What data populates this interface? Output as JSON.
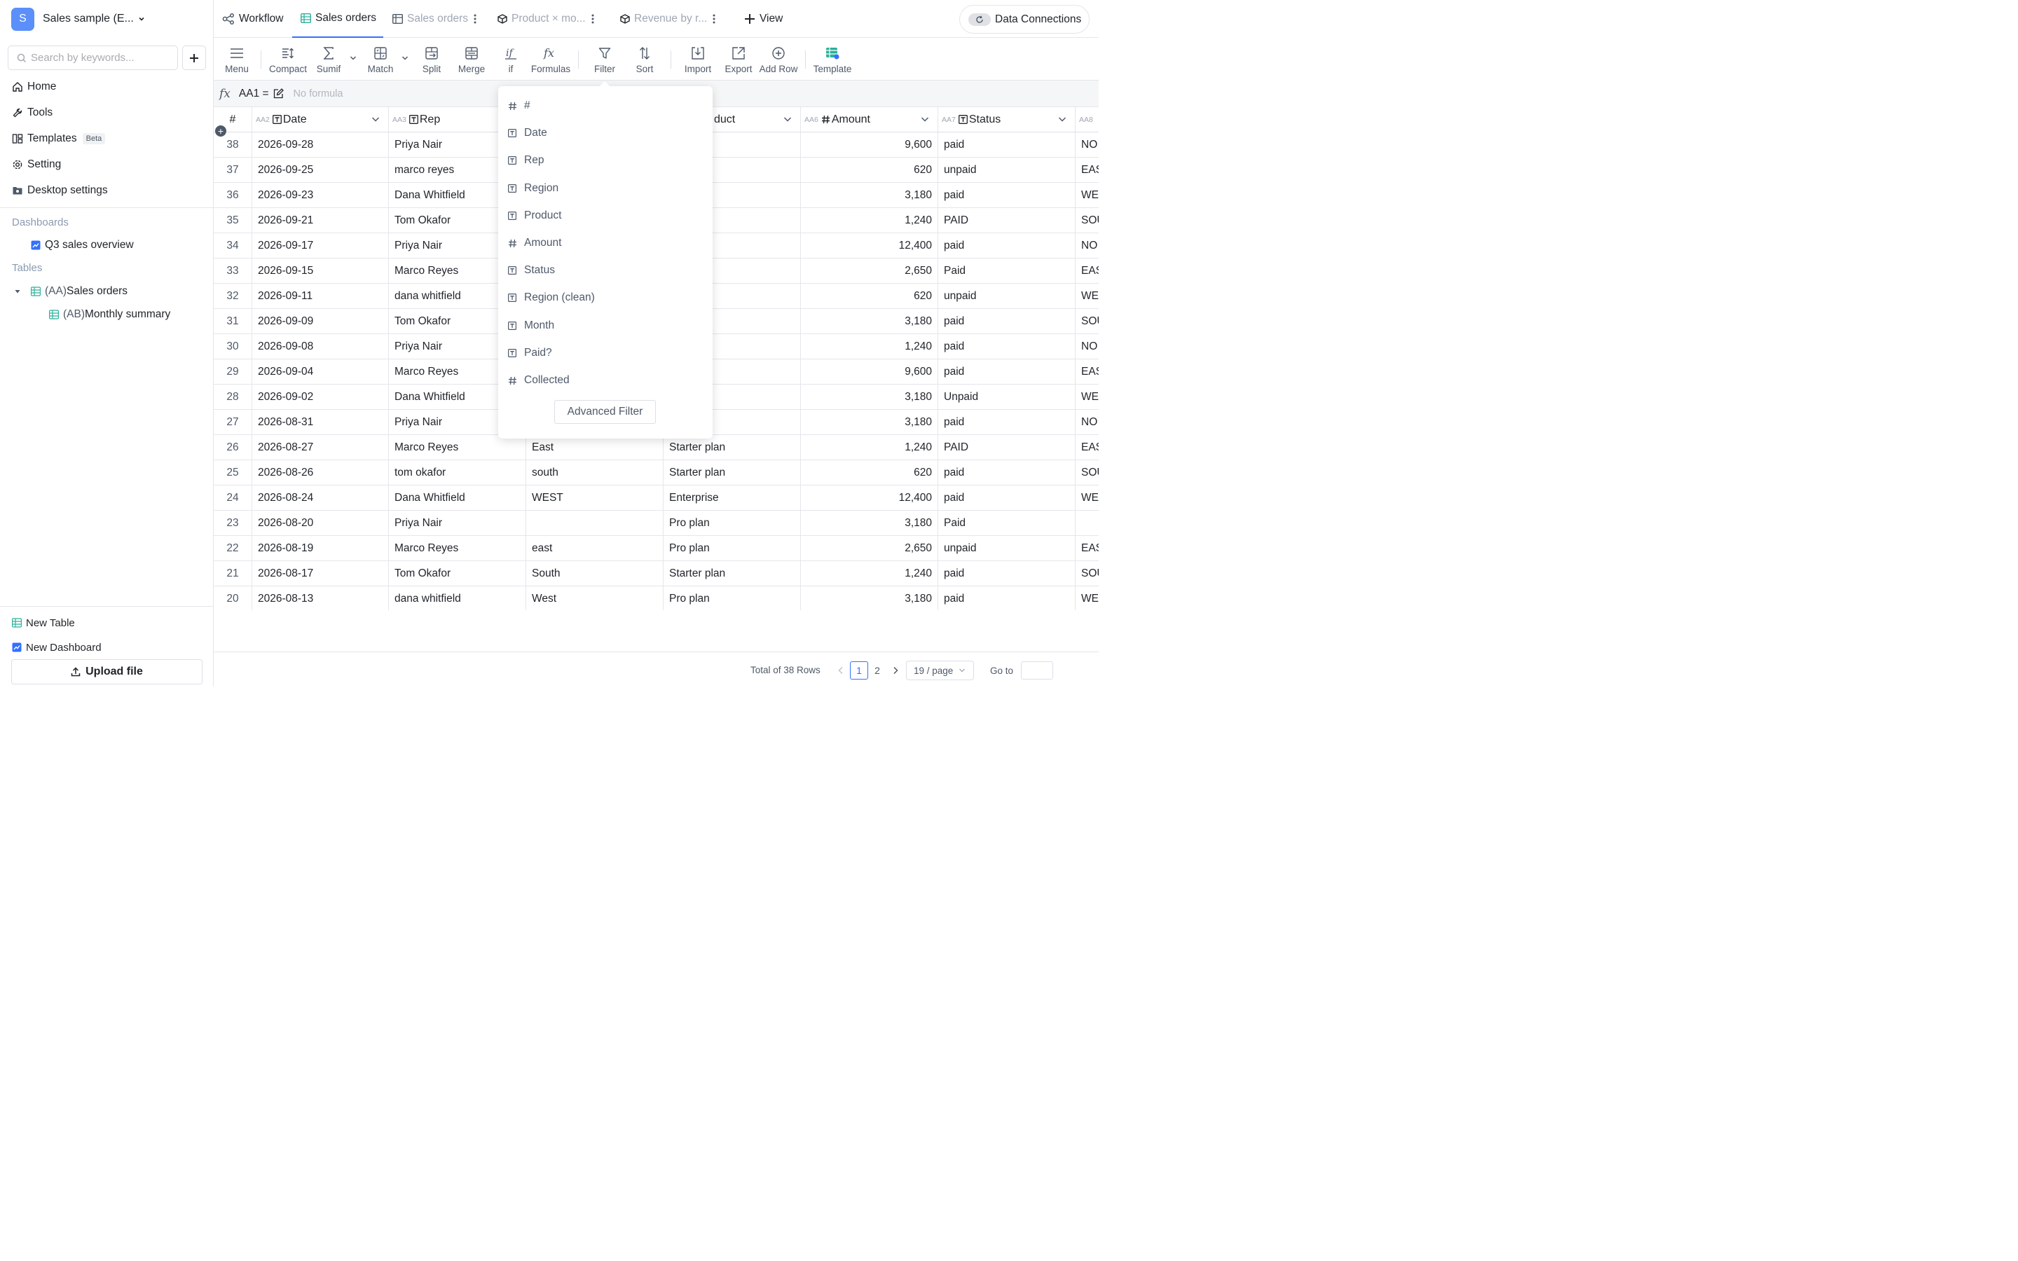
{
  "workspace": {
    "initial": "S",
    "name": "Sales sample (E..."
  },
  "search": {
    "placeholder": "Search by keywords..."
  },
  "nav": {
    "home": "Home",
    "tools": "Tools",
    "templates": "Templates",
    "templates_badge": "Beta",
    "setting": "Setting",
    "desktop": "Desktop settings"
  },
  "dashboards": {
    "title": "Dashboards",
    "items": [
      "Q3 sales overview"
    ]
  },
  "tables": {
    "title": "Tables",
    "sales_prefix": "(AA)",
    "sales_name": "Sales orders",
    "monthly_prefix": "(AB)",
    "monthly_name": "Monthly summary"
  },
  "bottom": {
    "new_table": "New Table",
    "new_dashboard": "New Dashboard",
    "upload": "Upload file"
  },
  "tabs": [
    {
      "label": "Workflow"
    },
    {
      "label": "Sales orders"
    },
    {
      "label": "Sales orders"
    },
    {
      "label": "Product × mo..."
    },
    {
      "label": "Revenue by r..."
    },
    {
      "label": "View"
    }
  ],
  "data_connections": "Data Connections",
  "toolbar": [
    "Menu",
    "Compact",
    "Sumif",
    "Match",
    "Split",
    "Merge",
    "if",
    "Formulas",
    "Filter",
    "Sort",
    "Import",
    "Export",
    "Add Row",
    "Template"
  ],
  "formula": {
    "cellref": "AA1 =",
    "text": "No formula"
  },
  "columns": [
    {
      "id": "",
      "name": "#"
    },
    {
      "id": "AA2",
      "name": "Date"
    },
    {
      "id": "AA3",
      "name": "Rep"
    },
    {
      "id": "",
      "name": ""
    },
    {
      "id": "",
      "name": "duct"
    },
    {
      "id": "AA6",
      "name": "Amount"
    },
    {
      "id": "AA7",
      "name": "Status"
    },
    {
      "id": "AA8",
      "name": ""
    }
  ],
  "rows": [
    {
      "n": "38",
      "date": "2026-09-28",
      "rep": "Priya Nair",
      "region": "",
      "product": "se",
      "amount": "9,600",
      "status": "paid",
      "r8": "NO"
    },
    {
      "n": "37",
      "date": "2026-09-25",
      "rep": "marco reyes",
      "region": "",
      "product": "lan",
      "amount": "620",
      "status": "unpaid",
      "r8": "EAS"
    },
    {
      "n": "36",
      "date": "2026-09-23",
      "rep": "Dana Whitfield",
      "region": "",
      "product": "",
      "amount": "3,180",
      "status": "paid",
      "r8": "WE"
    },
    {
      "n": "35",
      "date": "2026-09-21",
      "rep": "Tom Okafor",
      "region": "",
      "product": "lan",
      "amount": "1,240",
      "status": "PAID",
      "r8": "SOU"
    },
    {
      "n": "34",
      "date": "2026-09-17",
      "rep": "Priya Nair",
      "region": "",
      "product": "se",
      "amount": "12,400",
      "status": "paid",
      "r8": "NO"
    },
    {
      "n": "33",
      "date": "2026-09-15",
      "rep": "Marco Reyes",
      "region": "",
      "product": "",
      "amount": "2,650",
      "status": "Paid",
      "r8": "EAS"
    },
    {
      "n": "32",
      "date": "2026-09-11",
      "rep": "dana whitfield",
      "region": "",
      "product": "lan",
      "amount": "620",
      "status": "unpaid",
      "r8": "WE"
    },
    {
      "n": "31",
      "date": "2026-09-09",
      "rep": "Tom Okafor",
      "region": "",
      "product": "",
      "amount": "3,180",
      "status": "paid",
      "r8": "SOU"
    },
    {
      "n": "30",
      "date": "2026-09-08",
      "rep": "Priya Nair",
      "region": "",
      "product": "lan",
      "amount": "1,240",
      "status": "paid",
      "r8": "NO"
    },
    {
      "n": "29",
      "date": "2026-09-04",
      "rep": "Marco Reyes",
      "region": "",
      "product": "se",
      "amount": "9,600",
      "status": "paid",
      "r8": "EAS"
    },
    {
      "n": "28",
      "date": "2026-09-02",
      "rep": "Dana Whitfield",
      "region": "",
      "product": "",
      "amount": "3,180",
      "status": "Unpaid",
      "r8": "WE"
    },
    {
      "n": "27",
      "date": "2026-08-31",
      "rep": "Priya Nair",
      "region": "",
      "product": "",
      "amount": "3,180",
      "status": "paid",
      "r8": "NO"
    },
    {
      "n": "26",
      "date": "2026-08-27",
      "rep": "Marco Reyes",
      "region": "East",
      "product": "Starter plan",
      "amount": "1,240",
      "status": "PAID",
      "r8": "EAS"
    },
    {
      "n": "25",
      "date": "2026-08-26",
      "rep": "tom okafor",
      "region": "south",
      "product": "Starter plan",
      "amount": "620",
      "status": "paid",
      "r8": "SOU"
    },
    {
      "n": "24",
      "date": "2026-08-24",
      "rep": "Dana Whitfield",
      "region": "WEST",
      "product": "Enterprise",
      "amount": "12,400",
      "status": "paid",
      "r8": "WE"
    },
    {
      "n": "23",
      "date": "2026-08-20",
      "rep": "Priya Nair",
      "region": "",
      "product": "Pro plan",
      "amount": "3,180",
      "status": "Paid",
      "r8": ""
    },
    {
      "n": "22",
      "date": "2026-08-19",
      "rep": "Marco Reyes",
      "region": "east",
      "product": "Pro plan",
      "amount": "2,650",
      "status": "unpaid",
      "r8": "EAS"
    },
    {
      "n": "21",
      "date": "2026-08-17",
      "rep": "Tom Okafor",
      "region": "South",
      "product": "Starter plan",
      "amount": "1,240",
      "status": "paid",
      "r8": "SOU"
    },
    {
      "n": "20",
      "date": "2026-08-13",
      "rep": "dana whitfield",
      "region": "West",
      "product": "Pro plan",
      "amount": "3,180",
      "status": "paid",
      "r8": "WE"
    }
  ],
  "filter_fields": [
    {
      "type": "number",
      "label": "#"
    },
    {
      "type": "text",
      "label": "Date"
    },
    {
      "type": "text",
      "label": "Rep"
    },
    {
      "type": "text",
      "label": "Region"
    },
    {
      "type": "text",
      "label": "Product"
    },
    {
      "type": "number",
      "label": "Amount"
    },
    {
      "type": "text",
      "label": "Status"
    },
    {
      "type": "text",
      "label": "Region (clean)"
    },
    {
      "type": "text",
      "label": "Month"
    },
    {
      "type": "text",
      "label": "Paid?"
    },
    {
      "type": "number",
      "label": "Collected"
    }
  ],
  "advanced_filter": "Advanced Filter",
  "pagination": {
    "total": "Total of 38 Rows",
    "pages": [
      "1",
      "2"
    ],
    "current": "1",
    "page_size": "19 / page",
    "goto": "Go to"
  },
  "colors": {
    "accent": "#3370ff",
    "table_icon": "#2bb09a",
    "dashboard_icon": "#3370ff"
  }
}
